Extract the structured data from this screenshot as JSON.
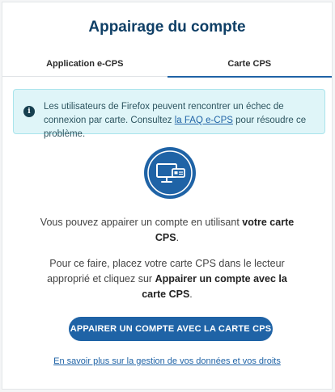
{
  "header": {
    "title": "Appairage du compte"
  },
  "tabs": [
    {
      "label": "Application e-CPS",
      "active": false
    },
    {
      "label": "Carte CPS",
      "active": true
    }
  ],
  "alert": {
    "icon": "info-icon",
    "text_before": "Les utilisateurs de Firefox peuvent rencontrer un échec de connexion par carte. Consultez ",
    "link_text": "la FAQ e-CPS",
    "text_after": " pour résoudre ce problème."
  },
  "illustration": {
    "icon": "computer-card-reader-icon"
  },
  "body": {
    "p1_before": "Vous pouvez appairer un compte en utilisant ",
    "p1_bold": "votre carte CPS",
    "p1_after": ".",
    "p2_before": "Pour ce faire, placez votre carte CPS dans le lecteur approprié et cliquez sur ",
    "p2_bold": "Appairer un compte avec la carte CPS",
    "p2_after": "."
  },
  "cta": {
    "label": "APPAIRER UN COMPTE AVEC LA CARTE CPS"
  },
  "footer": {
    "link": "En savoir plus sur la gestion de vos données et vos droits"
  },
  "colors": {
    "primary": "#1f63a6",
    "title": "#0f3f66",
    "alert_bg": "#dff5f8"
  }
}
